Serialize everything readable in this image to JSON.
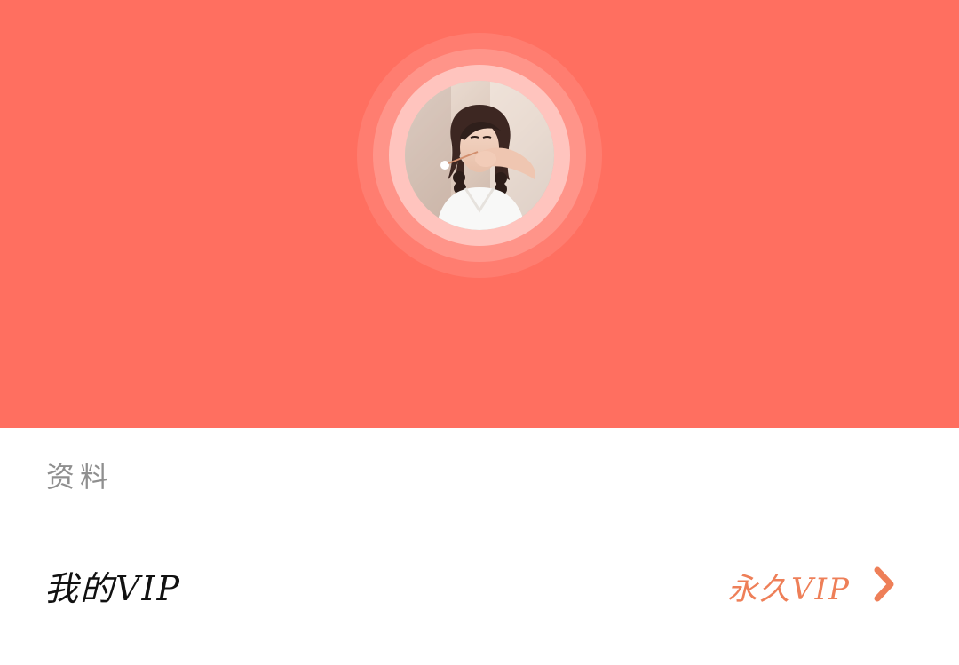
{
  "colors": {
    "hero_background": "#ff6f60",
    "page_background": "#ffffff",
    "section_title": "#8f8f8f",
    "row_label": "#111111",
    "accent": "#ee7f58"
  },
  "profile": {
    "avatar_icon": "user-photo"
  },
  "section": {
    "title": "资料"
  },
  "vip_row": {
    "label": "我的VIP",
    "value": "永久VIP",
    "chevron_icon": "chevron-right-icon"
  }
}
